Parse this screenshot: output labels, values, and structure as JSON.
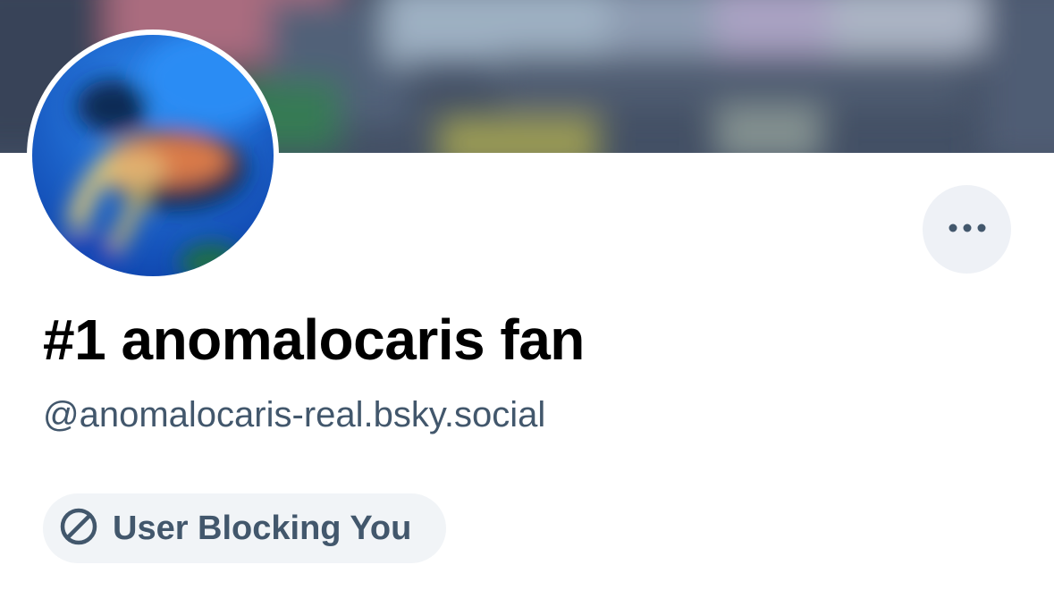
{
  "profile": {
    "display_name": "#1 anomalocaris fan",
    "handle": "@anomalocaris-real.bsky.social",
    "status_label": "User Blocking You"
  },
  "icons": {
    "more": "more-horizontal-icon",
    "blocked": "block-icon"
  },
  "colors": {
    "text_primary": "#000000",
    "text_secondary": "#42576c",
    "pill_background": "#f1f4f7",
    "button_background": "#eef1f6"
  }
}
